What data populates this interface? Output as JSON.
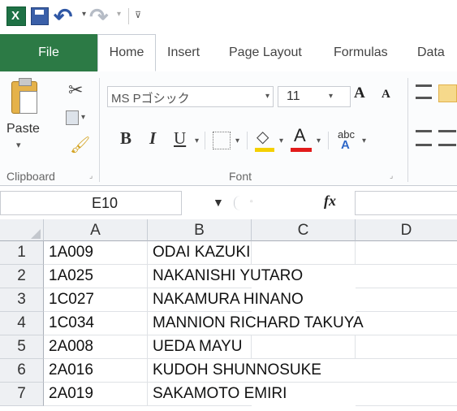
{
  "quick_access": {
    "icons": [
      "excel-logo-icon",
      "save-icon",
      "undo-icon",
      "redo-icon",
      "customize-icon"
    ],
    "dropdown_glyph": "▾"
  },
  "tabs": [
    "File",
    "Home",
    "Insert",
    "Page Layout",
    "Formulas",
    "Data"
  ],
  "ribbon": {
    "clipboard": {
      "paste_label": "Paste",
      "paste_arrow": "▾",
      "group_label": "Clipboard"
    },
    "font": {
      "font_name": "MS Pゴシック",
      "font_size": "11",
      "group_label": "Font",
      "bold": "B",
      "italic": "I",
      "underline": "U",
      "grow": "A",
      "shrink": "A",
      "fill_color": "#f4d000",
      "font_color": "#e21b1b"
    }
  },
  "formula_bar": {
    "name_box": "E10",
    "fx": "fx",
    "formula_value": ""
  },
  "sheet": {
    "columns": [
      "A",
      "B",
      "C",
      "D"
    ],
    "rows": [
      {
        "num": "1",
        "a": "1A009",
        "b": "ODAI KAZUKI"
      },
      {
        "num": "2",
        "a": "1A025",
        "b": "NAKANISHI YUTARO"
      },
      {
        "num": "3",
        "a": "1C027",
        "b": "NAKAMURA HINANO"
      },
      {
        "num": "4",
        "a": "1C034",
        "b": "MANNION RICHARD TAKUYA"
      },
      {
        "num": "5",
        "a": "2A008",
        "b": "UEDA MAYU"
      },
      {
        "num": "6",
        "a": "2A016",
        "b": "KUDOH SHUNNOSUKE"
      },
      {
        "num": "7",
        "a": "2A019",
        "b": "SAKAMOTO EMIRI"
      }
    ]
  }
}
